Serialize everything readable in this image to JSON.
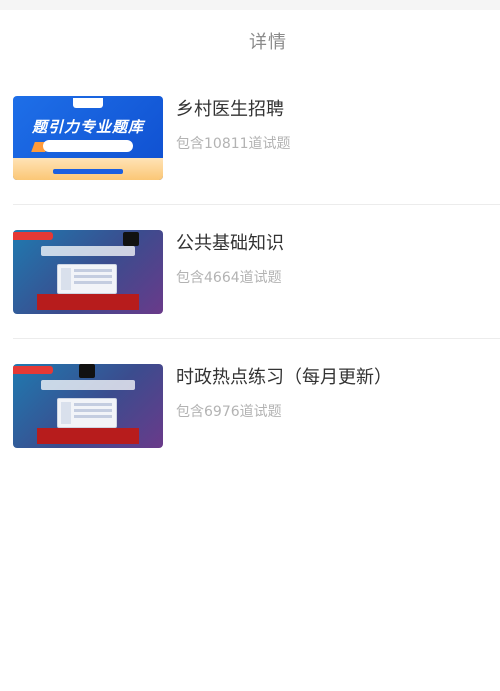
{
  "nav": {
    "title": "详情"
  },
  "items": [
    {
      "name": "乡村医生招聘",
      "count": "包含10811道试题",
      "thumb": {
        "style": "blue",
        "headline": "题引力专业题库"
      }
    },
    {
      "name": "公共基础知识",
      "count": "包含4664道试题",
      "thumb": {
        "style": "purple",
        "headline": ""
      }
    },
    {
      "name": "时政热点练习（每月更新）",
      "count": "包含6976道试题",
      "thumb": {
        "style": "purple-alt",
        "headline": ""
      }
    }
  ],
  "colors": {
    "title": "#8a8a8a",
    "count": "#b3b3b3",
    "divider": "#ececec"
  }
}
